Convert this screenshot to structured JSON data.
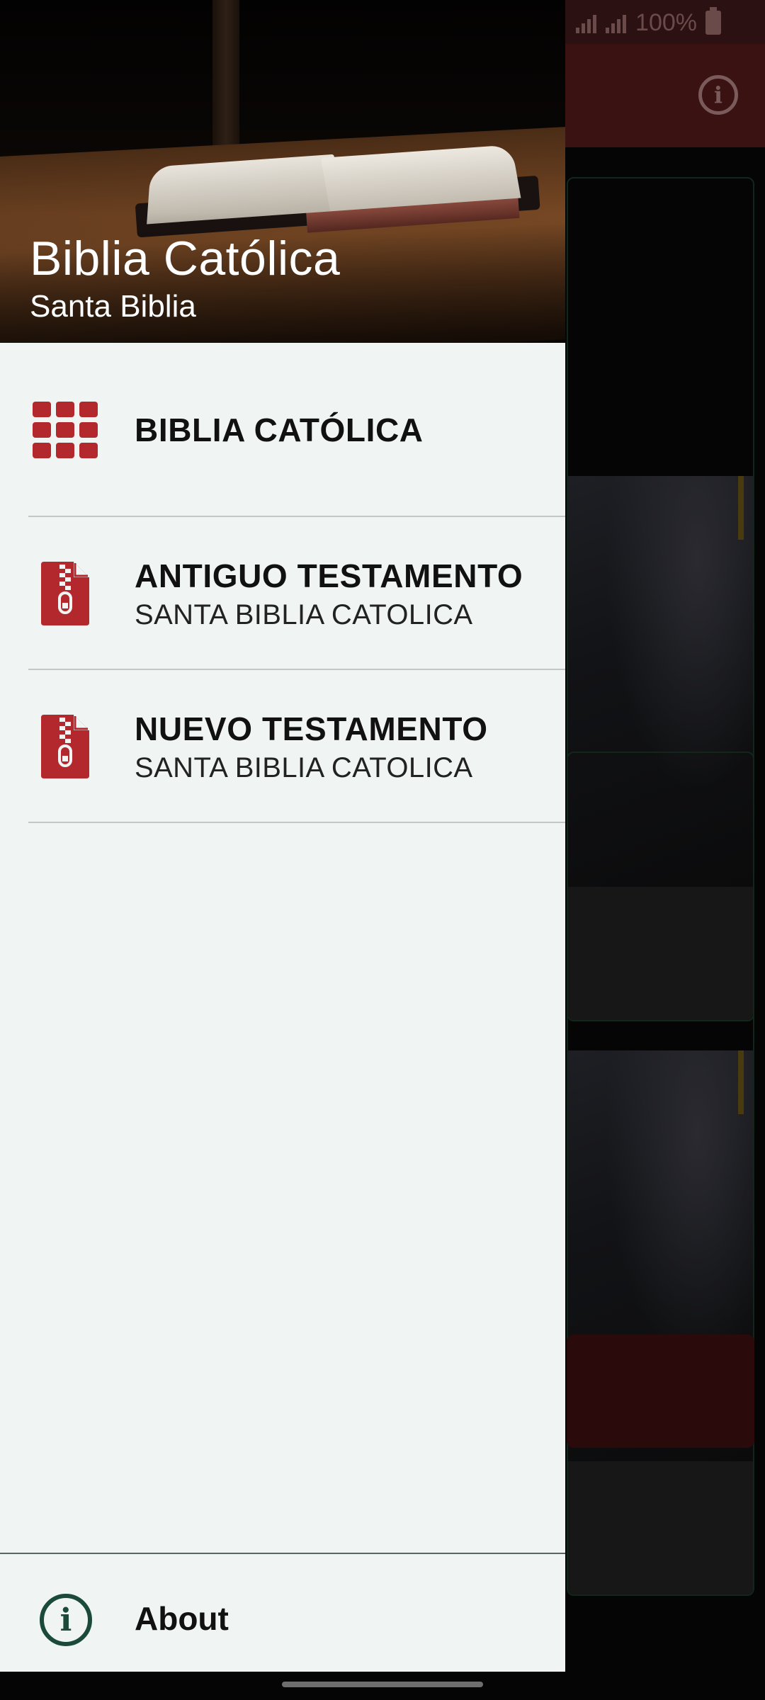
{
  "status_bar": {
    "battery_text": "100%"
  },
  "drawer": {
    "header": {
      "title": "Biblia Católica",
      "subtitle": "Santa Biblia"
    },
    "items": [
      {
        "title": "BIBLIA CATÓLICA",
        "subtitle": "",
        "icon": "grid-icon"
      },
      {
        "title": "ANTIGUO TESTAMENTO",
        "subtitle": "SANTA BIBLIA CATOLICA",
        "icon": "zip-file-icon"
      },
      {
        "title": "NUEVO TESTAMENTO",
        "subtitle": "SANTA BIBLIA CATOLICA",
        "icon": "zip-file-icon"
      }
    ],
    "footer": {
      "about_label": "About",
      "icon": "info-icon"
    }
  },
  "colors": {
    "accent_red": "#b3282d",
    "drawer_bg": "#f0f5f3",
    "about_icon": "#1c4a3a"
  }
}
